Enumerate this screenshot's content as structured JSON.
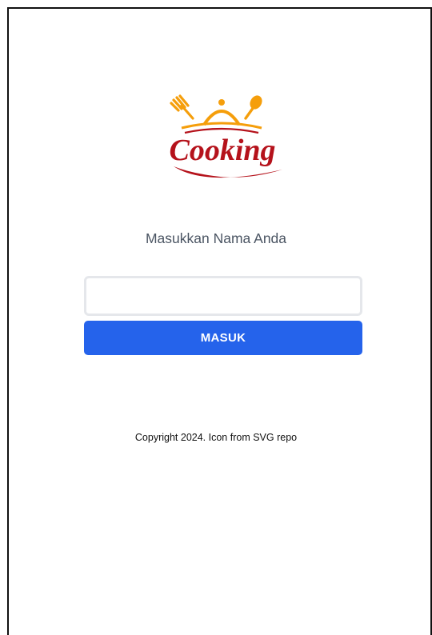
{
  "logo": {
    "text": "Cooking",
    "icon": "cooking-logo-icon",
    "colors": {
      "primary": "#b5121b",
      "accent": "#f59e0b"
    }
  },
  "form": {
    "prompt": "Masukkan Nama Anda",
    "name_input": {
      "value": "",
      "placeholder": ""
    },
    "submit_label": "MASUK"
  },
  "footer": {
    "copyright": "Copyright 2024. Icon from SVG repo"
  },
  "colors": {
    "button_bg": "#2563eb",
    "button_text": "#ffffff",
    "prompt_text": "#4b5563",
    "input_border": "#e5e7eb"
  }
}
